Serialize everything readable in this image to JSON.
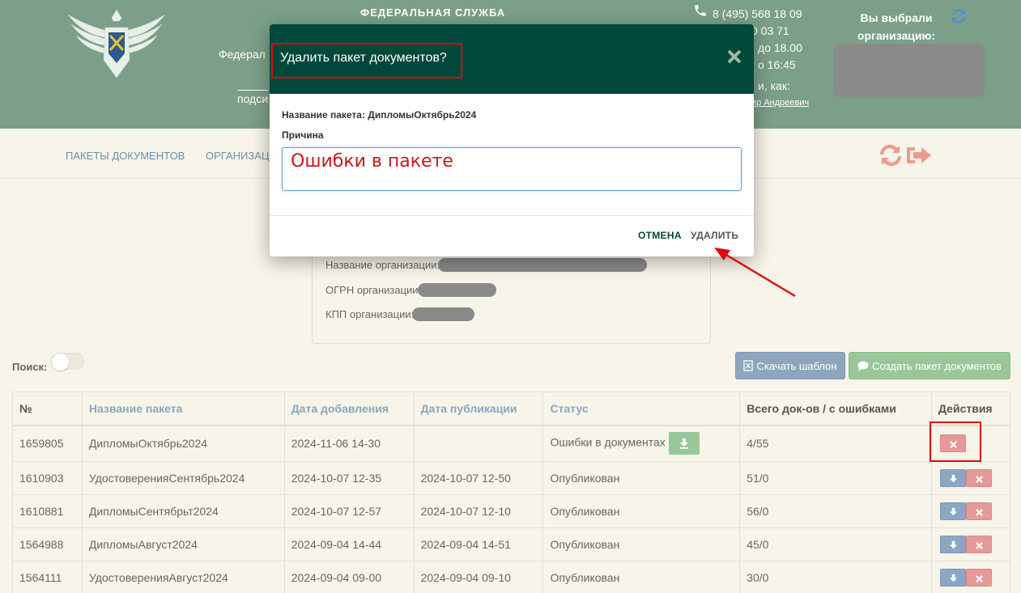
{
  "header": {
    "fed_title": "ФЕДЕРАЛЬНАЯ СЛУЖБА",
    "fed_fragment": "Федерал",
    "fed_fragment2": "подси",
    "phone": "8 (495) 568 18 09",
    "contact_lines": [
      "0 03 71",
      "до 18.00",
      "о 16:45",
      "и, как:"
    ],
    "contact_user": "ир Андреевич",
    "org_label": "Вы выбрали организацию:"
  },
  "nav": {
    "items": [
      "ПАКЕТЫ ДОКУМЕНТОВ",
      "ОРГАНИЗАЦИ"
    ]
  },
  "org_panel": {
    "name_label": "Название организации:",
    "ogrn_label": "ОГРН организации:",
    "kpp_label": "КПП организации:"
  },
  "search": {
    "label": "Поиск:"
  },
  "buttons": {
    "template": "Скачать шаблон",
    "create": "Создать пакет документов"
  },
  "table": {
    "headers": [
      "№",
      "Название пакета",
      "Дата добавления",
      "Дата публикации",
      "Статус",
      "Всего док-ов / с ошибками",
      "Действия"
    ],
    "rows": [
      {
        "id": "1659805",
        "name": "ДипломыОктябрь2024",
        "added": "2024-11-06 14-30",
        "published": "",
        "status": "Ошибки в документах",
        "docs": "4/55"
      },
      {
        "id": "1610903",
        "name": "УдостоверенияСентябрь2024",
        "added": "2024-10-07 12-35",
        "published": "2024-10-07 12-50",
        "status": "Опубликован",
        "docs": "51/0"
      },
      {
        "id": "1610881",
        "name": "ДипломыСентябрьт2024",
        "added": "2024-10-07 12-57",
        "published": "2024-10-07 12-10",
        "status": "Опубликован",
        "docs": "56/0"
      },
      {
        "id": "1564988",
        "name": "ДипломыАвгуст2024",
        "added": "2024-09-04 14-44",
        "published": "2024-09-04 14-51",
        "status": "Опубликован",
        "docs": "45/0"
      },
      {
        "id": "1564111",
        "name": "УдостоверенияАвгуст2024",
        "added": "2024-09-04 09-00",
        "published": "2024-09-04 09-10",
        "status": "Опубликован",
        "docs": "30/0"
      }
    ]
  },
  "modal": {
    "title": "Удалить пакет документов?",
    "package_label": "Название пакета: ДипломыОктябрь2024",
    "reason_label": "Причина",
    "reason_value": "Ошибки в пакете",
    "cancel": "ОТМЕНА",
    "delete": "УДАЛИТЬ"
  },
  "colors": {
    "header_bg": "#7b9f88",
    "modal_header_bg": "#00483a",
    "accent_red": "#e0090b",
    "link_blue": "#8aa7bd"
  }
}
